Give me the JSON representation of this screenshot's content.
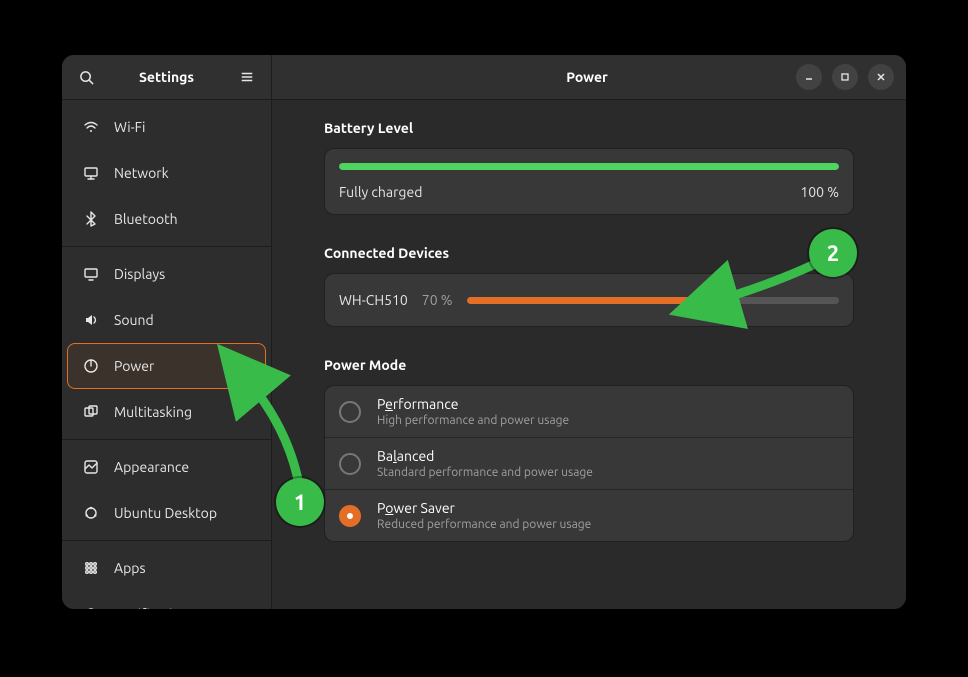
{
  "sidebar": {
    "title": "Settings",
    "groups": [
      [
        {
          "icon": "wifi",
          "label": "Wi-Fi"
        },
        {
          "icon": "network",
          "label": "Network"
        },
        {
          "icon": "bluetooth",
          "label": "Bluetooth"
        }
      ],
      [
        {
          "icon": "displays",
          "label": "Displays"
        },
        {
          "icon": "sound",
          "label": "Sound"
        },
        {
          "icon": "power",
          "label": "Power",
          "selected": true
        },
        {
          "icon": "multitask",
          "label": "Multitasking"
        }
      ],
      [
        {
          "icon": "appearance",
          "label": "Appearance"
        },
        {
          "icon": "ubuntu",
          "label": "Ubuntu Desktop"
        }
      ],
      [
        {
          "icon": "apps",
          "label": "Apps"
        },
        {
          "icon": "notifications",
          "label": "Notifications"
        }
      ]
    ]
  },
  "main": {
    "title": "Power",
    "battery": {
      "section_title": "Battery Level",
      "status": "Fully charged",
      "percent_label": "100 %",
      "percent": 100
    },
    "devices": {
      "section_title": "Connected Devices",
      "items": [
        {
          "name": "WH-CH510",
          "percent_label": "70 %",
          "percent": 70
        }
      ]
    },
    "power_mode": {
      "section_title": "Power Mode",
      "options": [
        {
          "title_pre": "P",
          "title_ul": "e",
          "title_post": "rformance",
          "desc": "High performance and power usage",
          "selected": false
        },
        {
          "title_pre": "Ba",
          "title_ul": "l",
          "title_post": "anced",
          "desc": "Standard performance and power usage",
          "selected": false
        },
        {
          "title_pre": "P",
          "title_ul": "o",
          "title_post": "wer Saver",
          "desc": "Reduced performance and power usage",
          "selected": true
        }
      ]
    }
  },
  "annotations": {
    "badge1": "1",
    "badge2": "2"
  },
  "colors": {
    "accent": "#e56e26",
    "battery_fill": "#4ed560",
    "annotation": "#39bb4a"
  }
}
